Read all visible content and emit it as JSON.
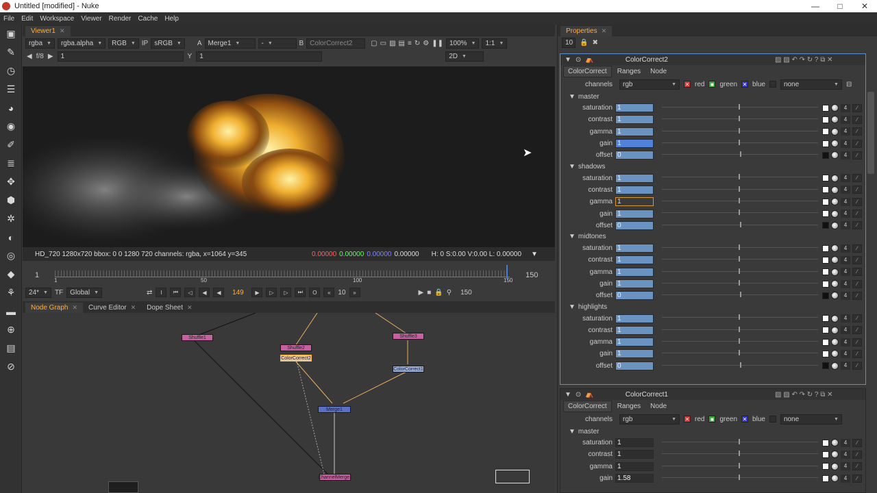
{
  "window": {
    "title": "Untitled [modified] - Nuke",
    "minimize": "—",
    "maximize": "□",
    "close": "✕"
  },
  "menu": [
    "File",
    "Edit",
    "Workspace",
    "Viewer",
    "Render",
    "Cache",
    "Help"
  ],
  "left_tools": [
    "pointer-icon",
    "paint-icon",
    "time-icon",
    "channel-icon",
    "color-icon",
    "filter-icon",
    "draw-icon",
    "layers-icon",
    "transform-icon",
    "3d-icon",
    "particles-icon",
    "deep-icon",
    "view-icon",
    "keyer-icon",
    "merge-icon",
    "toolsets-icon",
    "other-icon",
    "vr-icon",
    "help-icon"
  ],
  "viewer": {
    "tab": "Viewer1",
    "channels": "rgba",
    "alpha": "rgba.alpha",
    "mode": "RGB",
    "ip": "IP",
    "lut": "sRGB",
    "a_label": "A",
    "a_input": "Merge1",
    "wipe": "-",
    "b_label": "B",
    "b_input": "ColorCorrect2",
    "zoom": "100%",
    "ratio": "1:1",
    "fstop": "f/8",
    "gain_val": "1",
    "gamma_label": "Y",
    "gamma_val": "1",
    "view_mode": "2D",
    "info": "HD_720 1280x720  bbox: 0 0 1280 720 channels: rgba,  x=1064 y=345",
    "r": "0.00000",
    "g": "0.00000",
    "b": "0.00000",
    "a": "0.00000",
    "hsv": "H:  0 S:0.00 V:0.00   L: 0.00000"
  },
  "timeline": {
    "start": "1",
    "ticks": [
      "1",
      "50",
      "100",
      "150"
    ],
    "current": "149",
    "end": "150",
    "fps": "24*",
    "tf": "TF",
    "scope": "Global",
    "step": "10",
    "end2": "150"
  },
  "nodegraph_tabs": [
    "Node Graph",
    "Curve Editor",
    "Dope Sheet"
  ],
  "nodes": [
    "Shuffle1",
    "Shuffle2",
    "ColorCorrect2",
    "Shuffle3",
    "ColorCorrect1",
    "Merge1",
    "ChannelMerge1"
  ],
  "properties": {
    "tab": "Properties",
    "max_panels": "10",
    "panels": [
      {
        "name": "ColorCorrect2",
        "tabs": [
          "ColorCorrect",
          "Ranges",
          "Node"
        ],
        "channels": "rgb",
        "chk": [
          "red",
          "green",
          "blue"
        ],
        "mask": "none",
        "sections": [
          {
            "title": "master",
            "rows": [
              [
                "saturation",
                "1"
              ],
              [
                "contrast",
                "1"
              ],
              [
                "gamma",
                "1"
              ],
              [
                "gain",
                "1"
              ],
              [
                "offset",
                "0"
              ]
            ]
          },
          {
            "title": "shadows",
            "rows": [
              [
                "saturation",
                "1"
              ],
              [
                "contrast",
                "1"
              ],
              [
                "gamma",
                "1"
              ],
              [
                "gain",
                "1"
              ],
              [
                "offset",
                "0"
              ]
            ]
          },
          {
            "title": "midtones",
            "rows": [
              [
                "saturation",
                "1"
              ],
              [
                "contrast",
                "1"
              ],
              [
                "gamma",
                "1"
              ],
              [
                "gain",
                "1"
              ],
              [
                "offset",
                "0"
              ]
            ]
          },
          {
            "title": "highlights",
            "rows": [
              [
                "saturation",
                "1"
              ],
              [
                "contrast",
                "1"
              ],
              [
                "gamma",
                "1"
              ],
              [
                "gain",
                "1"
              ],
              [
                "offset",
                "0"
              ]
            ]
          }
        ]
      },
      {
        "name": "ColorCorrect1",
        "tabs": [
          "ColorCorrect",
          "Ranges",
          "Node"
        ],
        "channels": "rgb",
        "chk": [
          "red",
          "green",
          "blue"
        ],
        "mask": "none",
        "sections": [
          {
            "title": "master",
            "rows": [
              [
                "saturation",
                "1"
              ],
              [
                "contrast",
                "1"
              ],
              [
                "gamma",
                "1"
              ],
              [
                "gain",
                "1.58"
              ]
            ]
          }
        ]
      }
    ]
  },
  "colors": {
    "accent": "#ffaf3d",
    "selection": "#5a8fd6",
    "field": "#6b93c1"
  }
}
